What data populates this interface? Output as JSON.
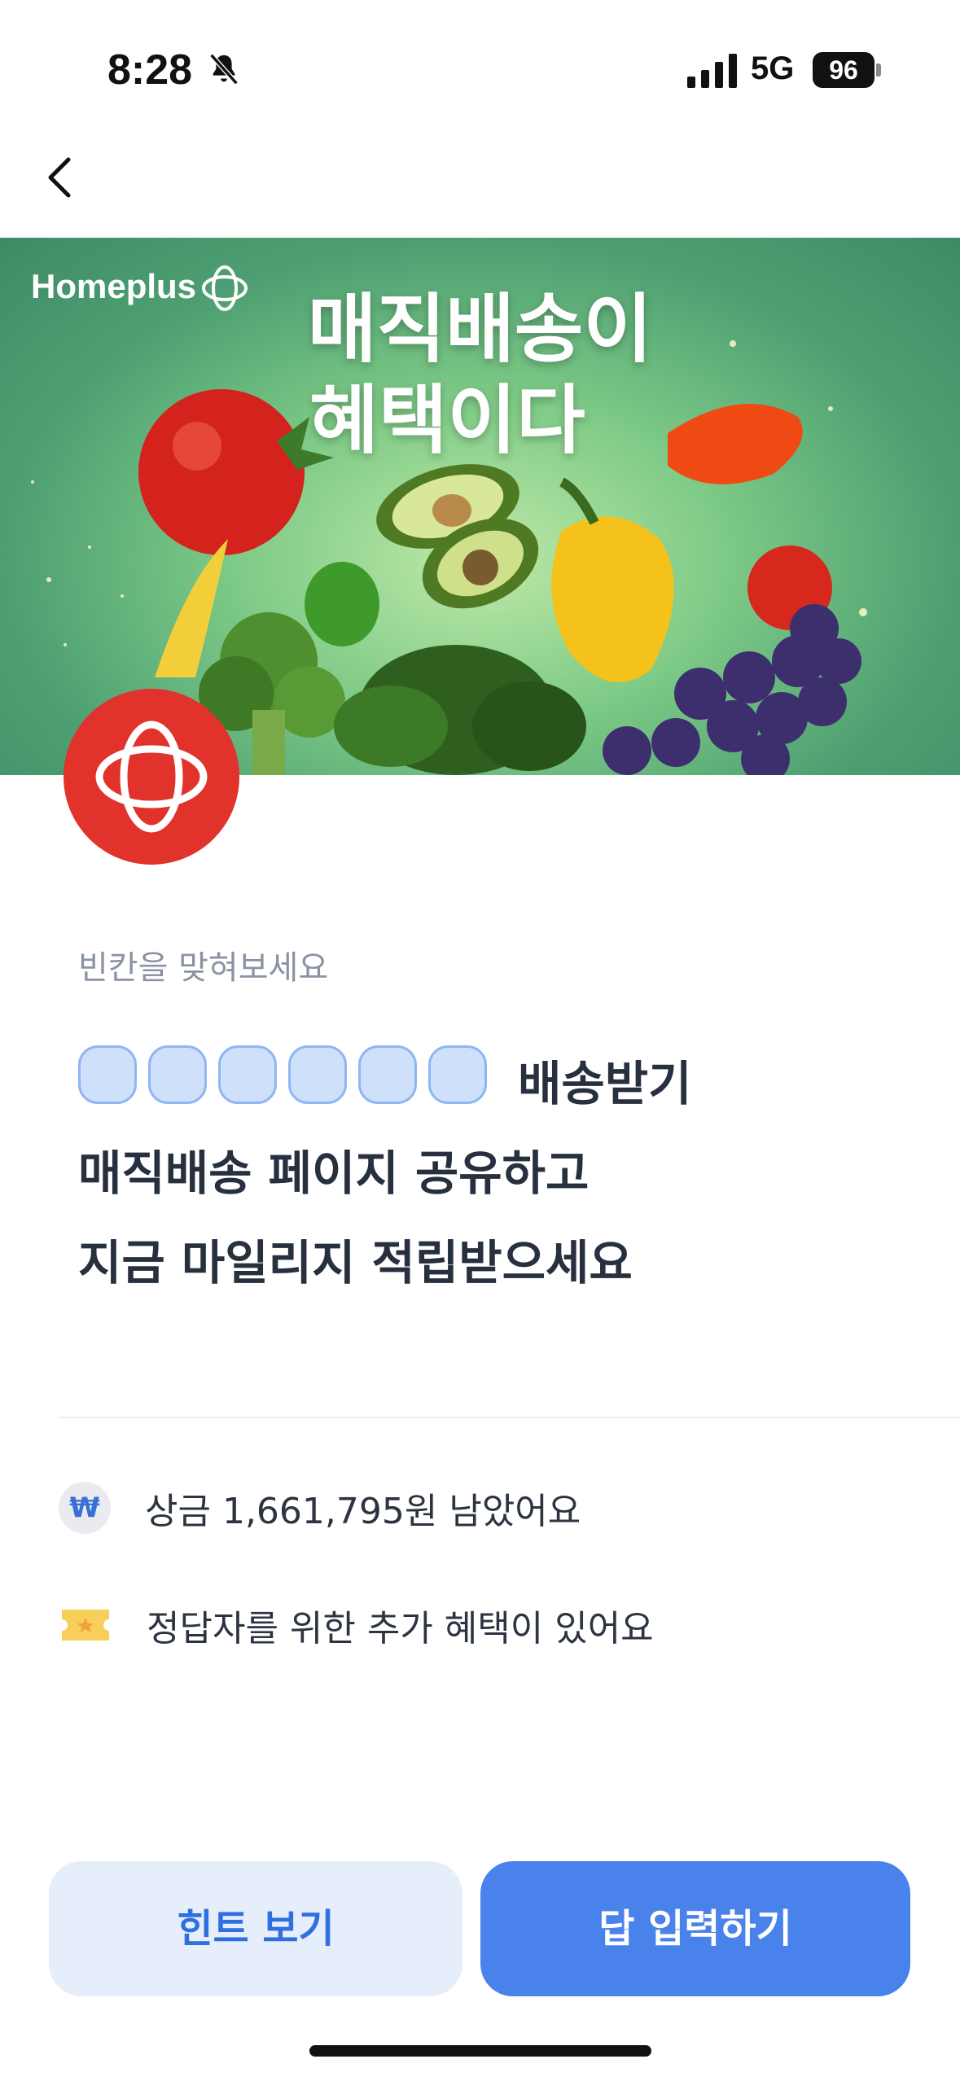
{
  "status_bar": {
    "time": "8:28",
    "network": "5G",
    "battery": "96",
    "icons": [
      "bell-slash-icon",
      "signal-icon",
      "battery-icon"
    ]
  },
  "nav": {
    "back_icon": "chevron-left-icon"
  },
  "banner": {
    "brand": "Homeplus",
    "headline_line1": "매직배송이",
    "headline_line2": "혜택이다"
  },
  "quiz": {
    "prompt": "빈칸을 맞혀보세요",
    "blank_count": 6,
    "line1_suffix": "배송받기",
    "line2": "매직배송 페이지 공유하고",
    "line3": "지금 마일리지 적립받으세요"
  },
  "info": {
    "prize_icon": "₩",
    "prize_text": "상금 1,661,795원 남았어요",
    "bonus_text": "정답자를 위한 추가 혜택이 있어요"
  },
  "actions": {
    "hint_label": "힌트 보기",
    "answer_label": "답 입력하기"
  },
  "colors": {
    "accent": "#4a82ec",
    "logo_red": "#e1322c",
    "blank_fill": "#cfe0fb"
  }
}
